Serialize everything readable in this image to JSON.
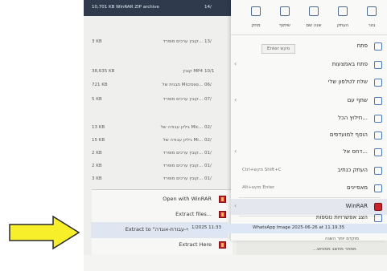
{
  "files": [
    {
      "size": "10,701 KB",
      "type": "WinRAR ZIP archive",
      "date": "14/"
    },
    {
      "size": "3 KB",
      "type": "קובץ ערכים מופרד...",
      "date": "13/"
    },
    {
      "size": "38,635 KB",
      "type": "קובץ MP4",
      "date": "10/1"
    },
    {
      "size": "721 KB",
      "type": "תבנית של Microso...",
      "date": "06/"
    },
    {
      "size": "5 KB",
      "type": "קובץ ערכים מופרד...",
      "date": "07/"
    },
    {
      "size": "13 KB",
      "type": "גיליון עבודה של Mic...",
      "date": "02/"
    },
    {
      "size": "15 KB",
      "type": "גיליון עבודה של Mi...",
      "date": "02/"
    },
    {
      "size": "2 KB",
      "type": "קובץ ערכים מופרד...",
      "date": "01/"
    },
    {
      "size": "2 KB",
      "type": "קובץ ערכים מופרד...",
      "date": "01/"
    },
    {
      "size": "3 KB",
      "type": "קובץ ערכים מופרד...",
      "date": "01/"
    }
  ],
  "winrar_menu": {
    "items": [
      {
        "label": "Open with WinRAR"
      },
      {
        "label": "Extract files..."
      },
      {
        "label": "Extract to \"יעדים-לפי-עבודת-אוגדה\\\""
      },
      {
        "label": "Extract Here"
      }
    ]
  },
  "toolbar": [
    {
      "label": "גזור",
      "icon": "cut-icon"
    },
    {
      "label": "העתק",
      "icon": "copy-icon"
    },
    {
      "label": "שנה שם",
      "icon": "rename-icon"
    },
    {
      "label": "שיתוף",
      "icon": "share-icon"
    },
    {
      "label": "מחק",
      "icon": "delete-icon"
    }
  ],
  "context_menu": {
    "enter_hint": "Enter מקש",
    "items": [
      {
        "label": "פתח",
        "shortcut": "",
        "icon": "open-icon",
        "chevron": false
      },
      {
        "label": "פתח באמצעות",
        "shortcut": "",
        "icon": "open-with-icon",
        "chevron": true
      },
      {
        "label": "שלח לטלפון שלי",
        "shortcut": "",
        "icon": "phone-icon",
        "chevron": false
      },
      {
        "label": "שתף עם",
        "shortcut": "",
        "icon": "share-with-icon",
        "chevron": true
      },
      {
        "label": "חילוץ הכל...",
        "shortcut": "",
        "icon": "extract-all-icon",
        "chevron": false
      },
      {
        "label": "הוסף למועדפים",
        "shortcut": "",
        "icon": "star-icon",
        "chevron": false
      },
      {
        "label": "דחס אל...",
        "shortcut": "",
        "icon": "compress-icon",
        "chevron": true
      },
      {
        "label": "העתק כנתיב",
        "shortcut": "Ctrl+מקש Shift+C",
        "icon": "copy-path-icon",
        "chevron": false
      },
      {
        "label": "מאפיינים",
        "shortcut": "Alt+מקש Enter",
        "icon": "properties-icon",
        "chevron": false
      },
      {
        "label": "WinRAR",
        "shortcut": "",
        "icon": "winrar-icon",
        "chevron": true
      },
      {
        "label": "הצג אפשרויות נוספות",
        "shortcut": "",
        "icon": "more-options-icon",
        "chevron": false
      }
    ]
  },
  "bottom": {
    "wa_time": "1/2025 11:33",
    "wa_file": "WhatsApp Image 2025-06-26 at 11.19.35",
    "line2": "מוקדם יותר השנה",
    "line3": "...ממחר מחשב ממוחש"
  },
  "colors": {
    "arrow_fill": "#f7ef2a",
    "arrow_stroke": "#2a2a2a",
    "winrar_red": "#c8242c",
    "highlight": "#dce6f4"
  }
}
